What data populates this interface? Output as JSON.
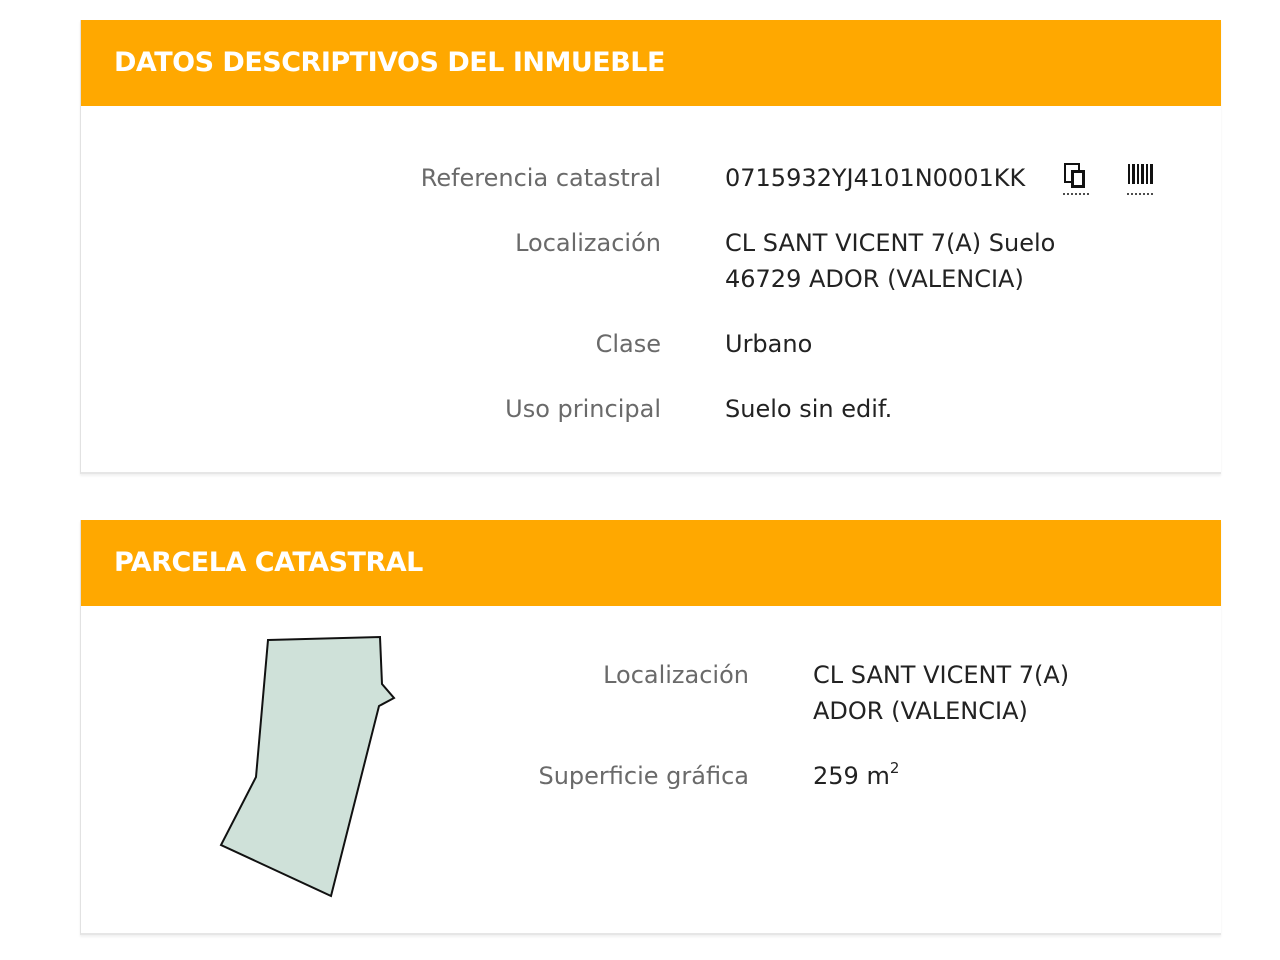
{
  "section_inmueble": {
    "title": "DATOS DESCRIPTIVOS DEL INMUEBLE",
    "referencia_label": "Referencia catastral",
    "referencia_value": "0715932YJ4101N0001KK",
    "copy_icon": "copy-icon",
    "barcode_icon": "barcode-icon",
    "localizacion_label": "Localización",
    "localizacion_line1": "CL SANT VICENT 7(A) Suelo",
    "localizacion_line2": "46729 ADOR (VALENCIA)",
    "clase_label": "Clase",
    "clase_value": "Urbano",
    "uso_label": "Uso principal",
    "uso_value": "Suelo sin edif."
  },
  "section_parcela": {
    "title": "PARCELA CATASTRAL",
    "localizacion_label": "Localización",
    "localizacion_line1": "CL SANT VICENT 7(A)",
    "localizacion_line2": "ADOR (VALENCIA)",
    "superficie_label": "Superficie gráfica",
    "superficie_value": "259 m",
    "superficie_unit_exp": "2",
    "parcel_fill": "#cfe1d9"
  },
  "colors": {
    "header_bg": "#ffa800",
    "header_text": "#ffffff",
    "label_text": "#6a6a6a",
    "value_text": "#222222"
  }
}
